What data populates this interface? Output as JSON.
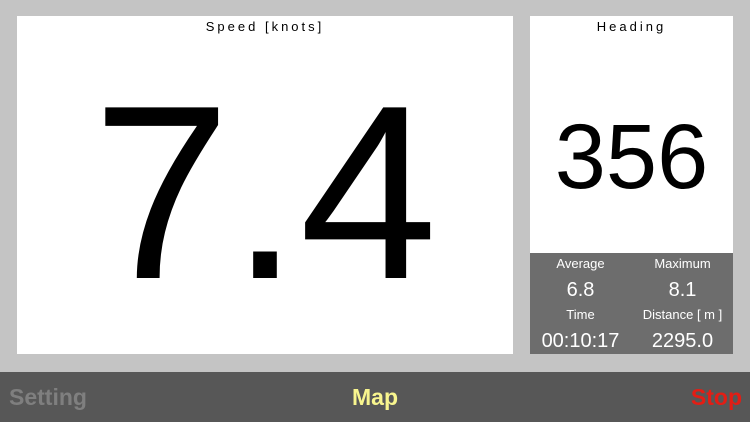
{
  "speed": {
    "title": "Speed [knots]",
    "value": "7.4"
  },
  "heading": {
    "title": "Heading",
    "value": "356"
  },
  "stats": {
    "average_label": "Average",
    "average_value": "6.8",
    "maximum_label": "Maximum",
    "maximum_value": "8.1",
    "time_label": "Time",
    "time_value": "00:10:17",
    "distance_label": "Distance [ m ]",
    "distance_value": "2295.0"
  },
  "toolbar": {
    "setting_label": "Setting",
    "map_label": "Map",
    "stop_label": "Stop"
  },
  "colors": {
    "background": "#c4c4c4",
    "stats_background": "#6d6d6d",
    "toolbar_background": "#575757",
    "setting_text": "#7f7f7f",
    "map_text": "#f8f58e",
    "stop_text": "#e31d14"
  }
}
